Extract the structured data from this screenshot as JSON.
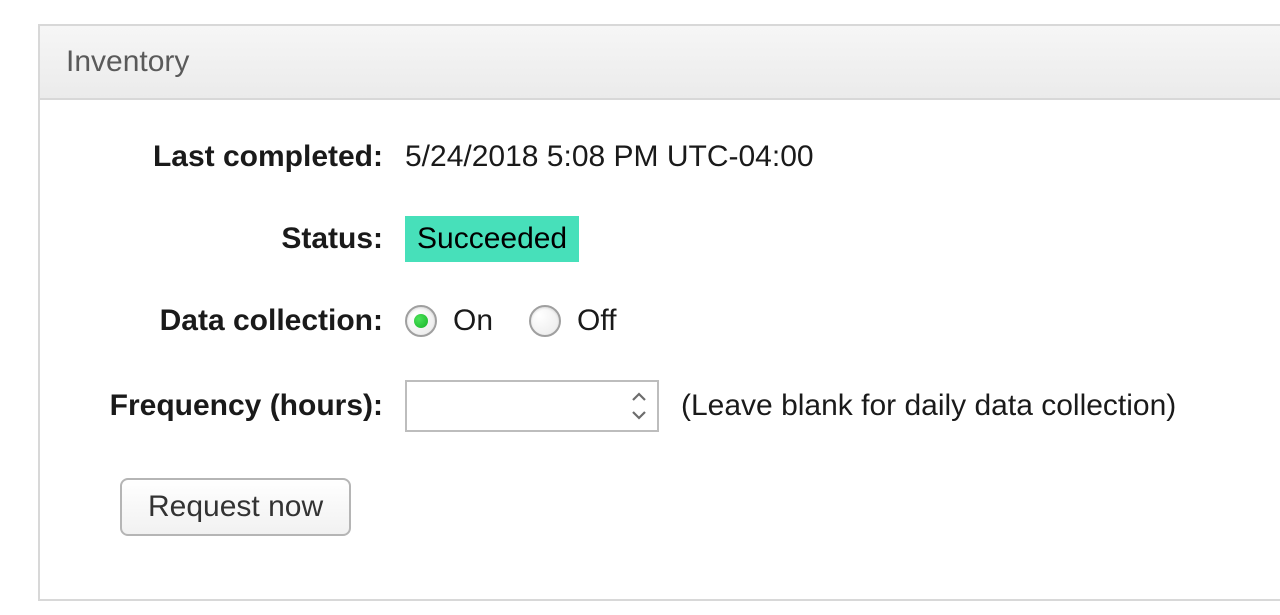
{
  "panel": {
    "title": "Inventory"
  },
  "labels": {
    "last_completed": "Last completed:",
    "status": "Status:",
    "data_collection": "Data collection:",
    "frequency": "Frequency (hours):"
  },
  "values": {
    "last_completed": "5/24/2018 5:08 PM UTC-04:00",
    "status": "Succeeded",
    "data_collection_selected": "On",
    "frequency": ""
  },
  "options": {
    "data_collection": {
      "on": "On",
      "off": "Off"
    }
  },
  "hints": {
    "frequency": "(Leave blank for daily data collection)"
  },
  "buttons": {
    "request_now": "Request now"
  },
  "colors": {
    "status_bg": "#47e0ba"
  }
}
